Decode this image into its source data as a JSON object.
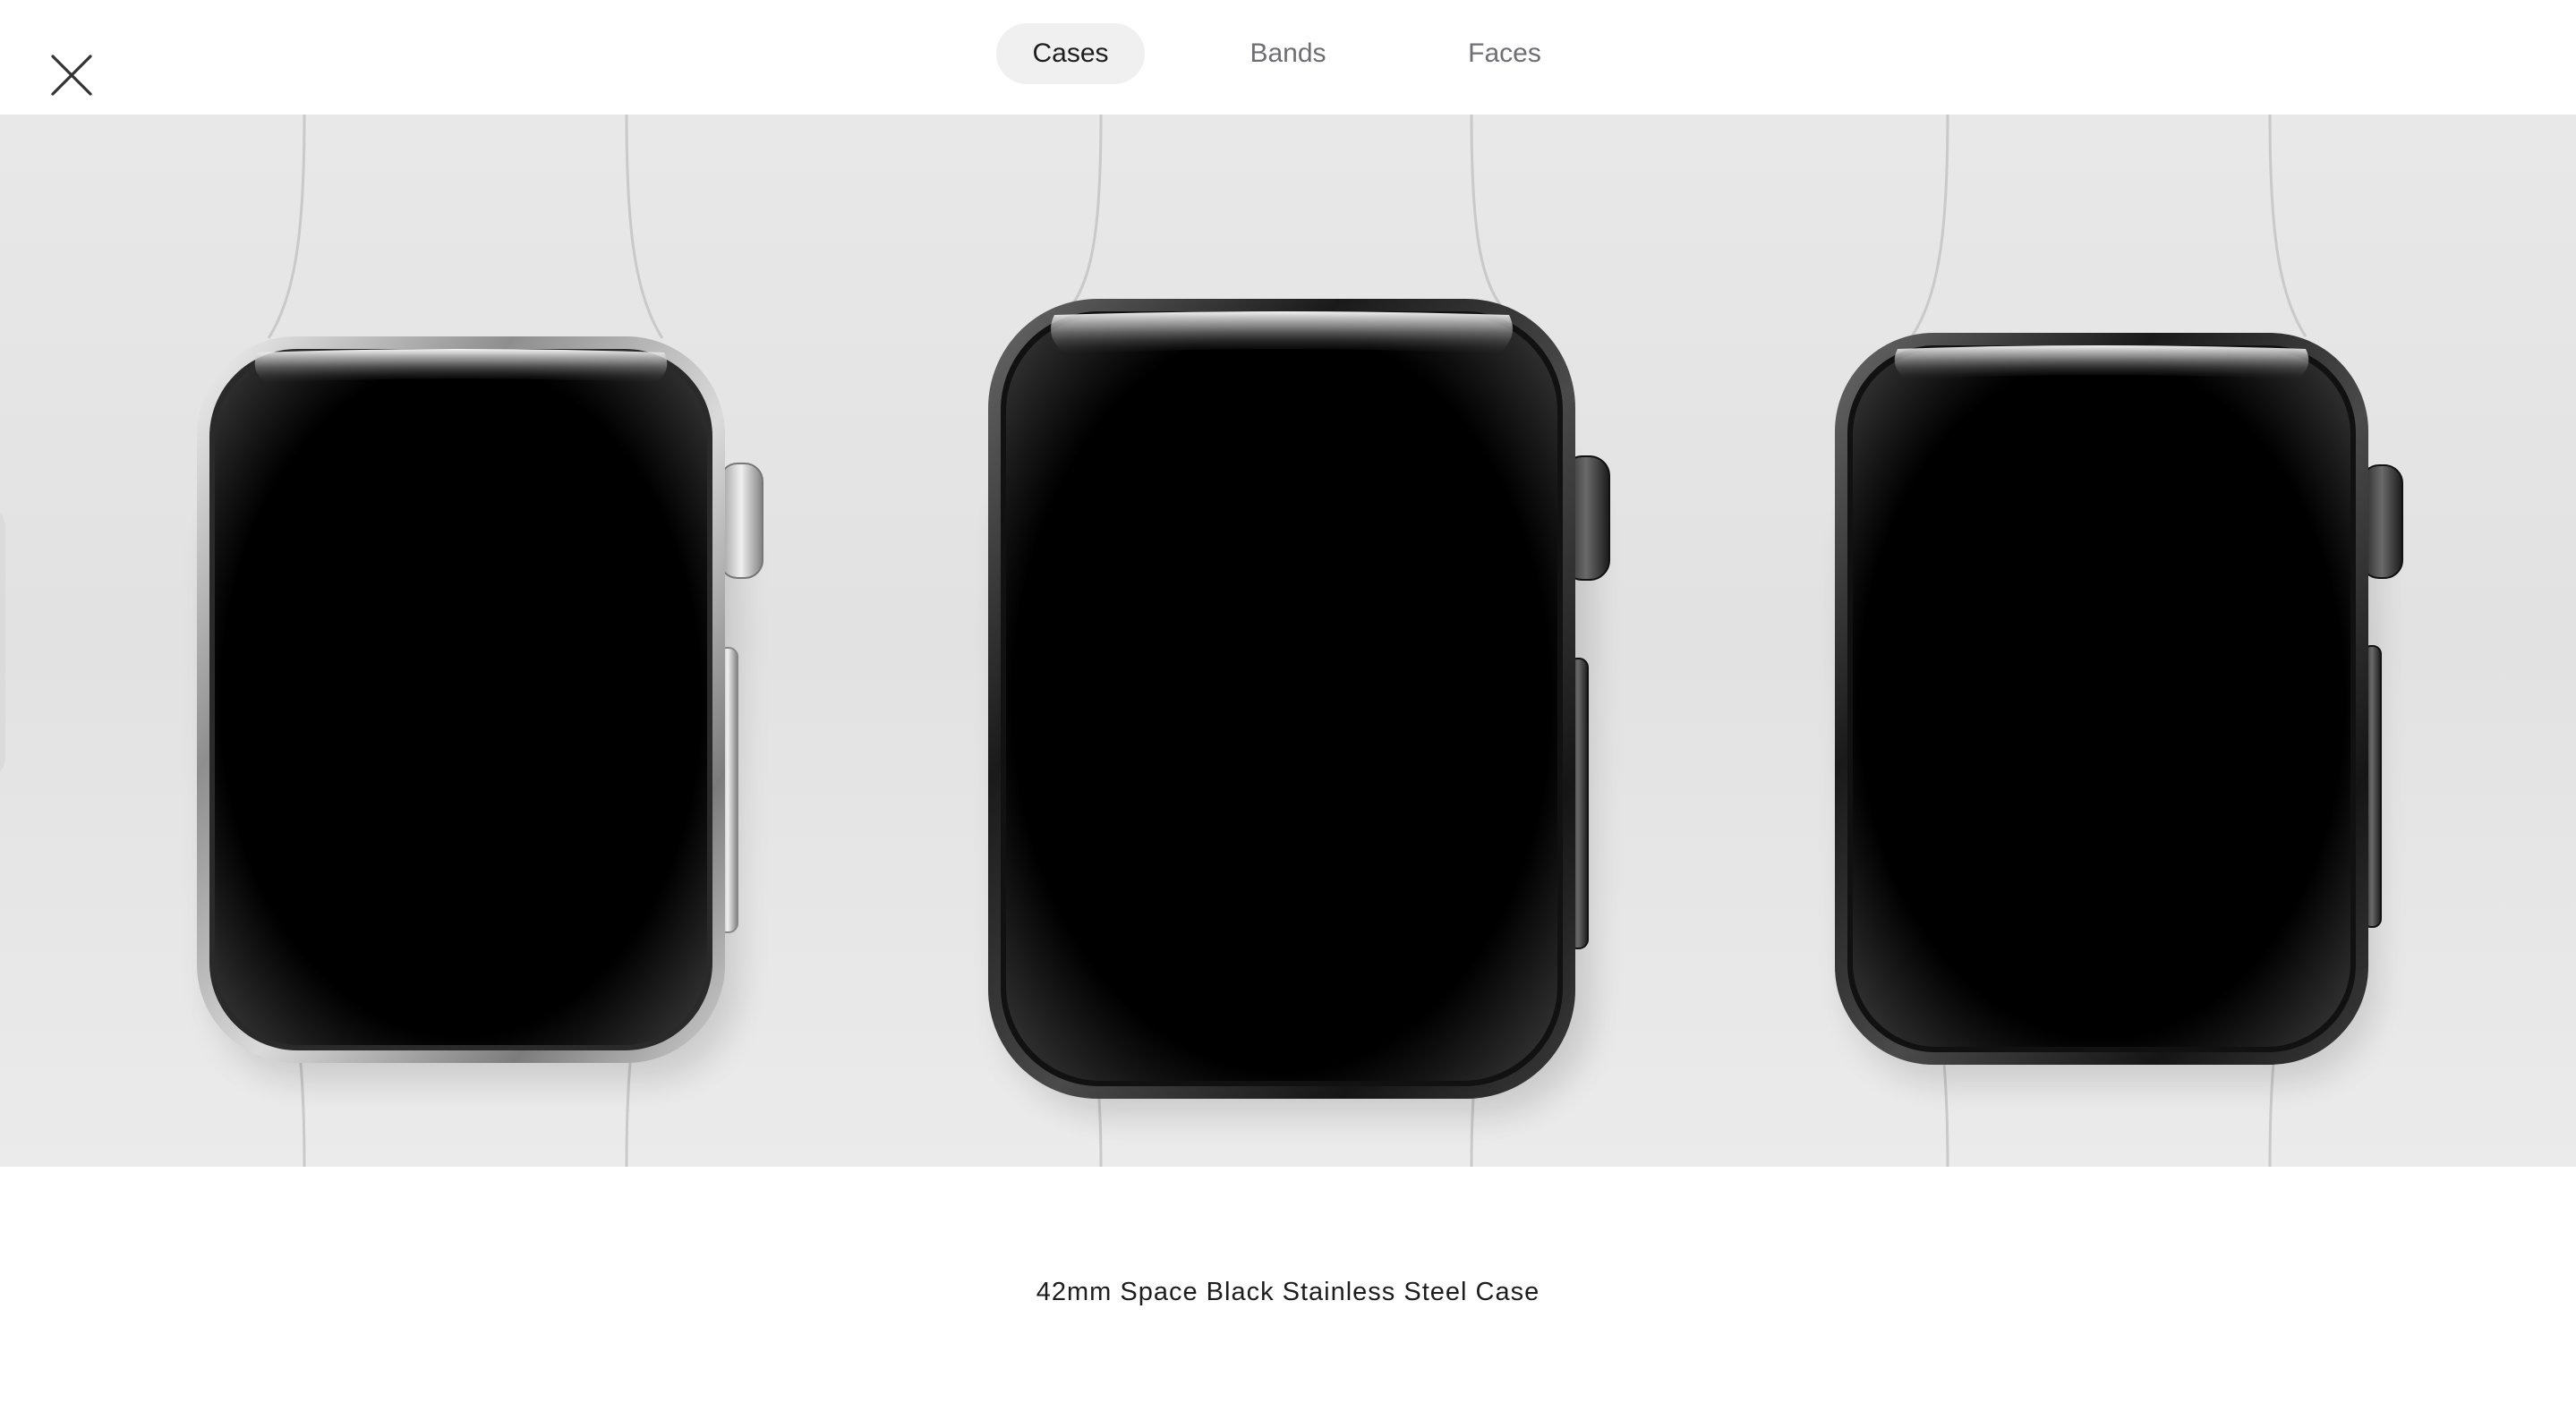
{
  "header": {
    "close_icon": "close-icon",
    "tabs": [
      {
        "label": "Cases",
        "active": true
      },
      {
        "label": "Bands",
        "active": false
      },
      {
        "label": "Faces",
        "active": false
      }
    ]
  },
  "stage": {
    "watches": [
      {
        "finish": "stainless steel",
        "band": "white sport band"
      },
      {
        "finish": "space black stainless steel",
        "band": "white sport band",
        "selected": true
      },
      {
        "finish": "space black stainless steel",
        "band": "white sport band"
      }
    ]
  },
  "caption": {
    "text": "42mm Space Black Stainless Steel Case"
  },
  "colors": {
    "active_tab_bg": "#f0f0f0",
    "inactive_tab_text": "#6e6e73",
    "text": "#1d1d1f",
    "stage_bg": "#e6e6e6"
  }
}
